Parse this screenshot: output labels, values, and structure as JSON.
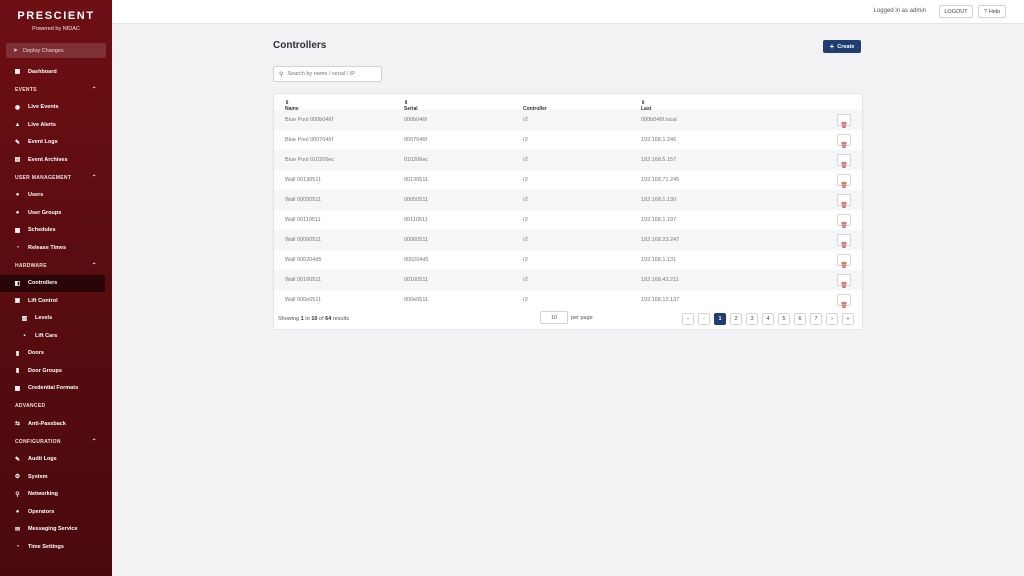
{
  "brand": {
    "name": "PRESCIENT",
    "powered_by": "Powered by NIDAC"
  },
  "deploy": {
    "label": "Deploy Changes"
  },
  "sidebar": {
    "dashboard": "Dashboard",
    "events": {
      "title": "EVENTS",
      "items": [
        "Live Events",
        "Live Alerts",
        "Event Logs",
        "Event Archives"
      ]
    },
    "user_management": {
      "title": "USER MANAGEMENT",
      "items": [
        "Users",
        "User Groups",
        "Schedules",
        "Release Times"
      ]
    },
    "hardware": {
      "title": "HARDWARE",
      "items": [
        "Controllers",
        "Lift Control",
        "Levels",
        "Lift Cars",
        "Doors",
        "Door Groups",
        "Credential Formats"
      ]
    },
    "advanced": {
      "title": "ADVANCED",
      "items": [
        "Anti-Passback"
      ]
    },
    "configuration": {
      "title": "CONFIGURATION",
      "items": [
        "Audit Logs",
        "System",
        "Networking",
        "Operators",
        "Messaging Service",
        "Time Settings"
      ]
    }
  },
  "topbar": {
    "logged_in": "Logged in as admin",
    "logout": "LOGOUT",
    "help": "Help"
  },
  "page": {
    "title": "Controllers",
    "create_label": "Create",
    "search_placeholder": "Search by name / serial / IP"
  },
  "table": {
    "headers": [
      "Name",
      "Serial",
      "Controller Revision",
      "Last Known Address"
    ],
    "rows": [
      [
        "Blue Pool 000b046f",
        "000b046f",
        "r2",
        "000b046f.local"
      ],
      [
        "Blue Pool 0007046f",
        "0007046f",
        "r2",
        "192.168.1.246"
      ],
      [
        "Blue Pool 010206ec",
        "010206ec",
        "r2",
        "192.168.5.157"
      ],
      [
        "Wall 00130511",
        "00130511",
        "r2",
        "192.168.71.245"
      ],
      [
        "Wall 00050511",
        "00050511",
        "r2",
        "192.168.1.130"
      ],
      [
        "Wall 00110511",
        "00110511",
        "r2",
        "192.168.1.197"
      ],
      [
        "Wall 00060511",
        "00060511",
        "r2",
        "192.168.23.247"
      ],
      [
        "Wall 000204d5",
        "000204d5",
        "r2",
        "192.168.1.131"
      ],
      [
        "Wall 00160511",
        "00160511",
        "r2",
        "192.168.43.211"
      ],
      [
        "Wall 000e0511",
        "000e0511",
        "r2",
        "192.168.12.137"
      ]
    ]
  },
  "pagination": {
    "showing_prefix": "Showing",
    "from": "1",
    "to_word": "to",
    "to": "10",
    "of_word": "of",
    "total": "64",
    "suffix": "results",
    "per_page_value": "10",
    "per_page_label": "per page",
    "pages": [
      "1",
      "2",
      "3",
      "4",
      "5",
      "6",
      "7"
    ],
    "first": "«",
    "prev": "‹",
    "next": "›",
    "last": "»"
  }
}
